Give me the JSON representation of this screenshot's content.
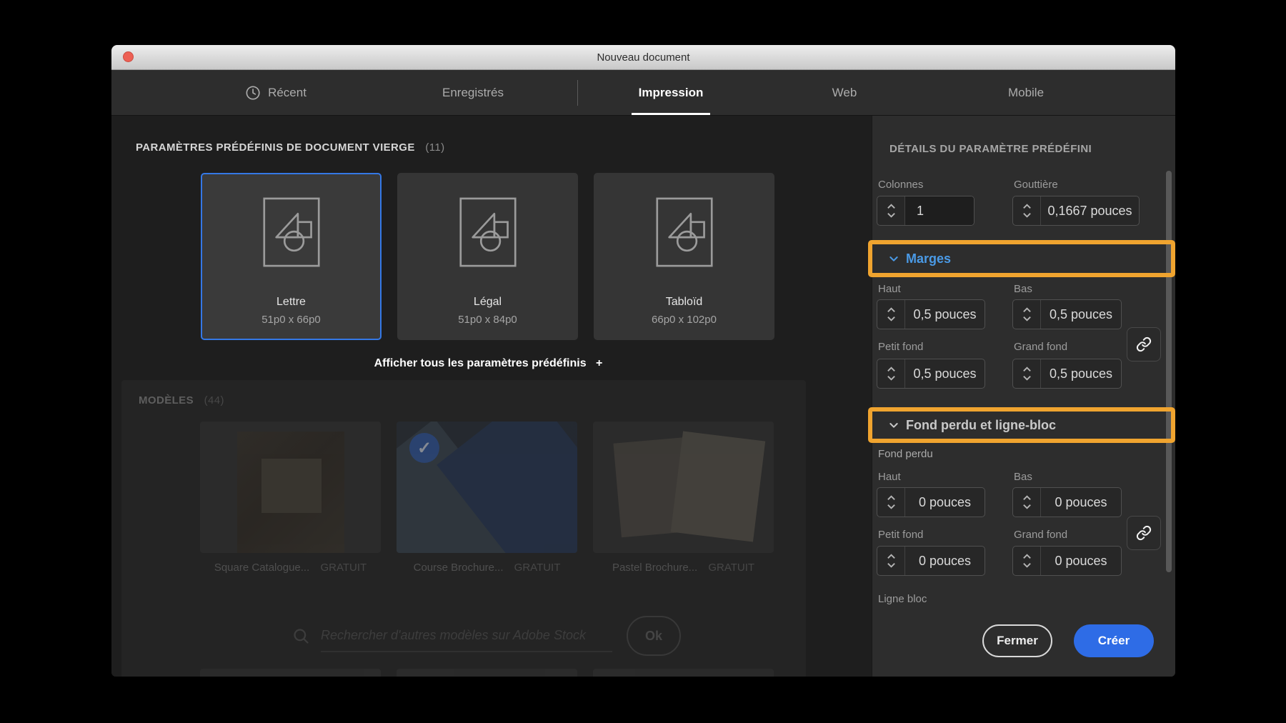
{
  "window": {
    "title": "Nouveau document"
  },
  "tabs": [
    {
      "label": "Récent",
      "icon": "clock-icon"
    },
    {
      "label": "Enregistrés"
    },
    {
      "label": "Impression",
      "active": true
    },
    {
      "label": "Web"
    },
    {
      "label": "Mobile"
    }
  ],
  "blank_presets": {
    "heading": "PARAMÈTRES PRÉDÉFINIS DE DOCUMENT VIERGE",
    "count": "(11)",
    "items": [
      {
        "name": "Lettre",
        "size": "51p0 x 66p0",
        "selected": true
      },
      {
        "name": "Légal",
        "size": "51p0 x 84p0",
        "selected": false
      },
      {
        "name": "Tabloïd",
        "size": "66p0 x 102p0",
        "selected": false
      }
    ],
    "show_all": "Afficher tous les paramètres prédéfinis",
    "show_all_plus": "+"
  },
  "templates": {
    "heading": "MODÈLES",
    "count": "(44)",
    "items": [
      {
        "name": "Square Catalogue...",
        "badge": "GRATUIT"
      },
      {
        "name": "Course Brochure...",
        "badge": "GRATUIT"
      },
      {
        "name": "Pastel Brochure...",
        "badge": "GRATUIT"
      }
    ],
    "search_placeholder": "Rechercher d'autres modèles sur Adobe Stock",
    "search_button": "Ok"
  },
  "details": {
    "heading": "DÉTAILS DU PARAMÈTRE PRÉDÉFINI",
    "colonnes": {
      "label": "Colonnes",
      "value": "1"
    },
    "gouttiere": {
      "label": "Gouttière",
      "value": "0,1667 pouces"
    },
    "marges": {
      "header": "Marges",
      "haut": {
        "label": "Haut",
        "value": "0,5 pouces"
      },
      "bas": {
        "label": "Bas",
        "value": "0,5 pouces"
      },
      "petit_fond": {
        "label": "Petit fond",
        "value": "0,5 pouces"
      },
      "grand_fond": {
        "label": "Grand fond",
        "value": "0,5 pouces"
      }
    },
    "fond_perdu": {
      "header": "Fond perdu et ligne-bloc",
      "subheading": "Fond perdu",
      "haut": {
        "label": "Haut",
        "value": "0 pouces"
      },
      "bas": {
        "label": "Bas",
        "value": "0 pouces"
      },
      "petit_fond": {
        "label": "Petit fond",
        "value": "0 pouces"
      },
      "grand_fond": {
        "label": "Grand fond",
        "value": "0 pouces"
      },
      "ligne_bloc": "Ligne bloc"
    }
  },
  "footer": {
    "close": "Fermer",
    "create": "Créer"
  },
  "colors": {
    "highlight_orange": "#f0a42f",
    "accent_blue": "#2e6ce6",
    "selected_card_border": "#3478e6",
    "marges_header_blue": "#4a9ae6",
    "titlebar_close_red": "#ed6054"
  }
}
